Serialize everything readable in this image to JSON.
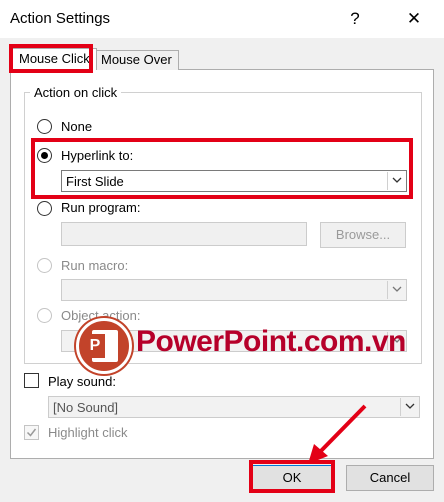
{
  "dialog": {
    "title": "Action Settings",
    "help_glyph": "?",
    "close_glyph": "✕"
  },
  "tabs": [
    {
      "label": "Mouse Click",
      "active": true
    },
    {
      "label": "Mouse Over",
      "active": false
    }
  ],
  "action_group": {
    "legend": "Action on click",
    "options": {
      "none": {
        "label": "None",
        "selected": false,
        "enabled": true
      },
      "hyperlink": {
        "label": "Hyperlink to:",
        "selected": true,
        "enabled": true,
        "value": "First Slide"
      },
      "run_program": {
        "label": "Run program:",
        "selected": false,
        "enabled": true,
        "value": "",
        "browse_label": "Browse..."
      },
      "run_macro": {
        "label": "Run macro:",
        "selected": false,
        "enabled": false,
        "value": ""
      },
      "object_action": {
        "label": "Object action:",
        "selected": false,
        "enabled": false,
        "value": ""
      }
    }
  },
  "sound": {
    "label": "Play sound:",
    "checked": false,
    "value": "[No Sound]"
  },
  "highlight": {
    "label": "Highlight click",
    "checked": true,
    "enabled": false
  },
  "buttons": {
    "ok": "OK",
    "cancel": "Cancel"
  },
  "watermark": {
    "text": "PowerPoint.com.vn",
    "logo_letter": "P"
  },
  "colors": {
    "annotation_red": "#e30016",
    "watermark_red": "#b6002a"
  }
}
